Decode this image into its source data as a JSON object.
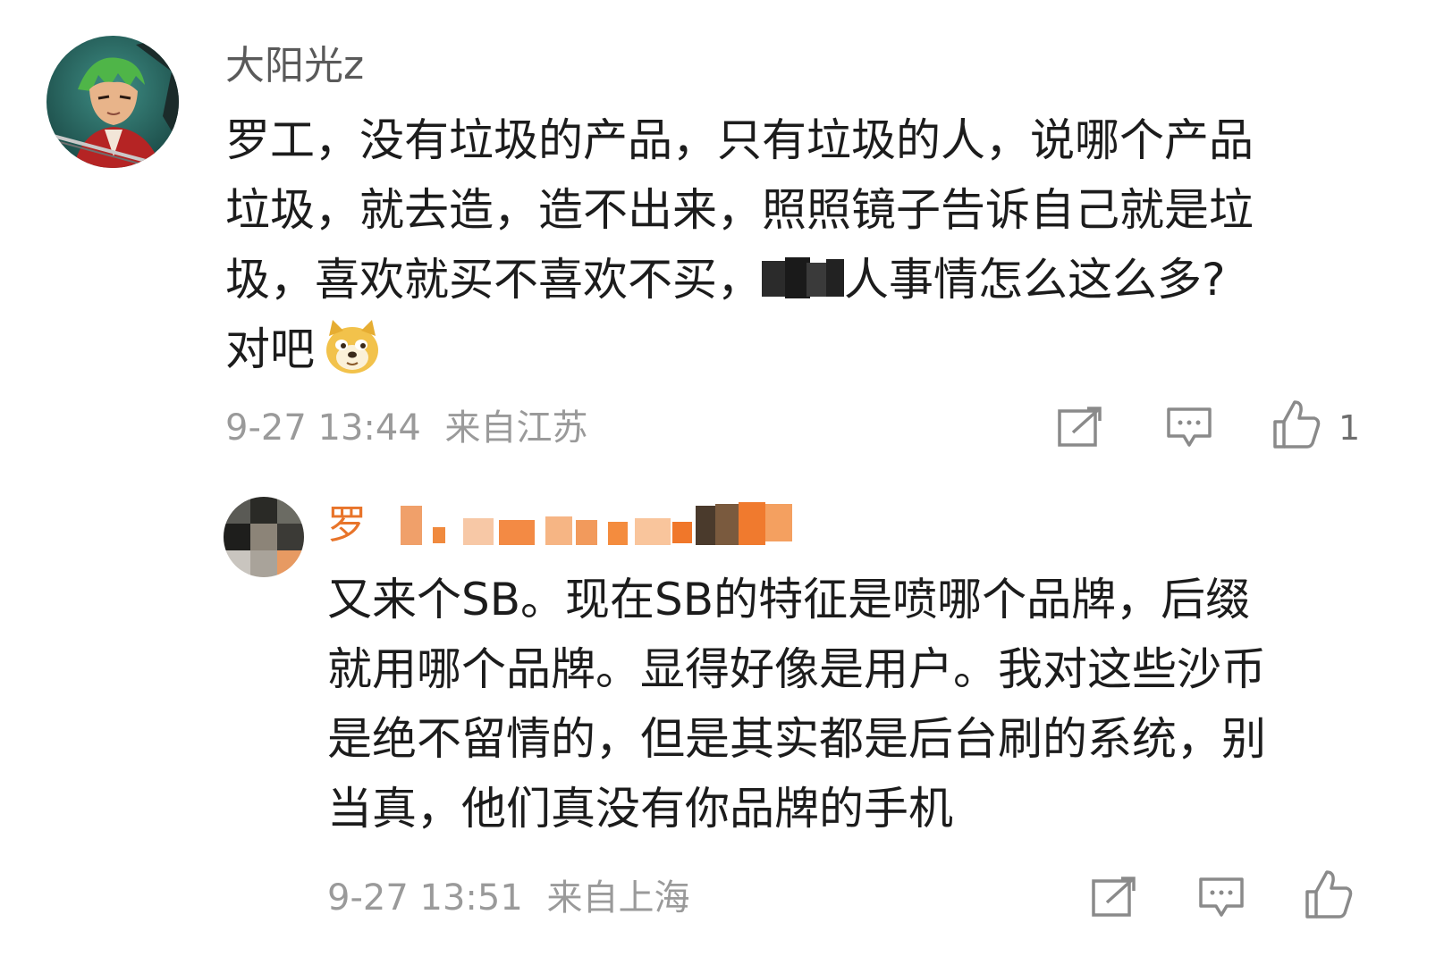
{
  "comment": {
    "username": "大阳光z",
    "lines": [
      "罗工，没有垃圾的产品，只有垃圾的人，说哪个产品",
      "垃圾，就去造，造不出来，照照镜子告诉自己就是垃",
      "圾，喜欢就买不喜欢不买，",
      "对吧"
    ],
    "line3_tail": "人事情怎么这么多?",
    "timestamp": "9-27 13:44",
    "location": "来自江苏",
    "like_count": "1",
    "icons": [
      "repost-icon",
      "comment-icon",
      "like-icon",
      "doge-emoji"
    ]
  },
  "reply": {
    "username": "罗",
    "lines": [
      "又来个SB。现在SB的特征是喷哪个品牌，后缀",
      "就用哪个品牌。显得好像是用户。我对这些沙币",
      "是绝不留情的，但是其实都是后台刷的系统，别",
      "当真，他们真没有你品牌的手机"
    ],
    "timestamp": "9-27 13:51",
    "location": "来自上海",
    "icons": [
      "repost-icon",
      "comment-icon",
      "like-icon"
    ]
  },
  "colors": {
    "text": "#1c1c1c",
    "meta": "#9a9a9a",
    "username": "#5a5a5a",
    "reply_username": "#e8742a",
    "icon": "#8a8a8a"
  }
}
